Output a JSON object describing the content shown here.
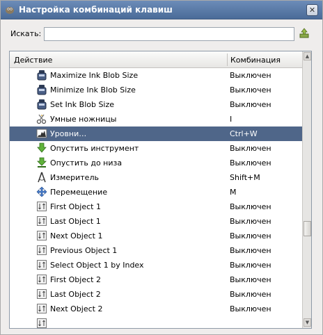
{
  "window": {
    "title": "Настройка комбинаций клавиш"
  },
  "search": {
    "label": "Искать:",
    "value": "",
    "placeholder": ""
  },
  "table": {
    "col_action": "Действие",
    "col_shortcut": "Комбинация",
    "rows": [
      {
        "label": "Maximize Ink Blob Size",
        "shortcut": "Выключен",
        "icon": "ink-icon"
      },
      {
        "label": "Minimize Ink Blob Size",
        "shortcut": "Выключен",
        "icon": "ink-icon"
      },
      {
        "label": "Set Ink Blob Size",
        "shortcut": "Выключен",
        "icon": "ink-icon"
      },
      {
        "label": "Умные ножницы",
        "shortcut": "I",
        "icon": "scissors-icon"
      },
      {
        "label": "Уровни…",
        "shortcut": "Ctrl+W",
        "icon": "levels-icon",
        "selected": true
      },
      {
        "label": "Опустить инструмент",
        "shortcut": "Выключен",
        "icon": "arrow-down-icon"
      },
      {
        "label": "Опустить до низа",
        "shortcut": "Выключен",
        "icon": "arrow-bottom-icon"
      },
      {
        "label": "Измеритель",
        "shortcut": "Shift+M",
        "icon": "measure-icon"
      },
      {
        "label": "Перемещение",
        "shortcut": "M",
        "icon": "move-icon"
      },
      {
        "label": "First Object 1",
        "shortcut": "Выключен",
        "icon": "object-icon"
      },
      {
        "label": "Last Object 1",
        "shortcut": "Выключен",
        "icon": "object-icon"
      },
      {
        "label": "Next Object 1",
        "shortcut": "Выключен",
        "icon": "object-icon"
      },
      {
        "label": "Previous Object 1",
        "shortcut": "Выключен",
        "icon": "object-icon"
      },
      {
        "label": "Select Object 1 by Index",
        "shortcut": "Выключен",
        "icon": "object-icon"
      },
      {
        "label": "First Object 2",
        "shortcut": "Выключен",
        "icon": "object-icon"
      },
      {
        "label": "Last Object 2",
        "shortcut": "Выключен",
        "icon": "object-icon"
      },
      {
        "label": "Next Object 2",
        "shortcut": "Выключен",
        "icon": "object-icon"
      },
      {
        "label": "",
        "shortcut": "",
        "icon": "object-icon"
      }
    ]
  },
  "colors": {
    "selection": "#4f6689",
    "titlebar": "#5a7aa8"
  }
}
